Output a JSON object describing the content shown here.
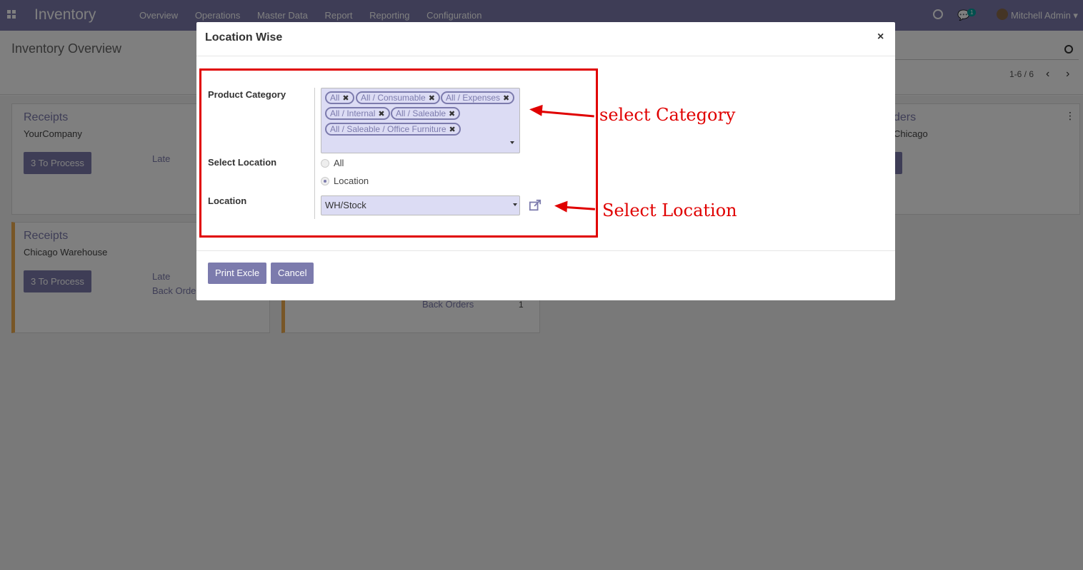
{
  "navbar": {
    "brand": "Inventory",
    "menu": [
      "Overview",
      "Operations",
      "Master Data",
      "Report",
      "Reporting",
      "Configuration"
    ],
    "chat_badge": "1",
    "user": "Mitchell Admin"
  },
  "control_panel": {
    "title": "Inventory Overview",
    "pager": "1-6 / 6"
  },
  "cards": [
    {
      "title": "Receipts",
      "subtitle": "YourCompany",
      "button": "3 To Process",
      "late": "Late"
    },
    {
      "title": "Receipts",
      "subtitle": "Chicago Warehouse",
      "button": "3 To Process",
      "late": "Late",
      "back_orders": "Back Orde"
    },
    {
      "back_orders_label": "Back Orders",
      "back_orders_count": "1"
    },
    {
      "title_partial": "ders",
      "subtitle_partial": "Chicago"
    }
  ],
  "modal": {
    "title": "Location Wise",
    "close": "×",
    "fields": {
      "product_category_label": "Product Category",
      "tags": [
        "All",
        "All / Consumable",
        "All / Expenses",
        "All / Internal",
        "All / Saleable",
        "All / Saleable / Office Furniture"
      ],
      "select_location_label": "Select Location",
      "radio_options": [
        "All",
        "Location"
      ],
      "radio_selected": "Location",
      "location_label": "Location",
      "location_value": "WH/Stock"
    },
    "buttons": {
      "print": "Print Excle",
      "cancel": "Cancel"
    }
  },
  "annotations": {
    "category": "select Category",
    "location": "Select Location"
  },
  "colors": {
    "brand": "#7c7bad",
    "annotation": "#e00000",
    "field_bg": "#dcdcf4"
  }
}
